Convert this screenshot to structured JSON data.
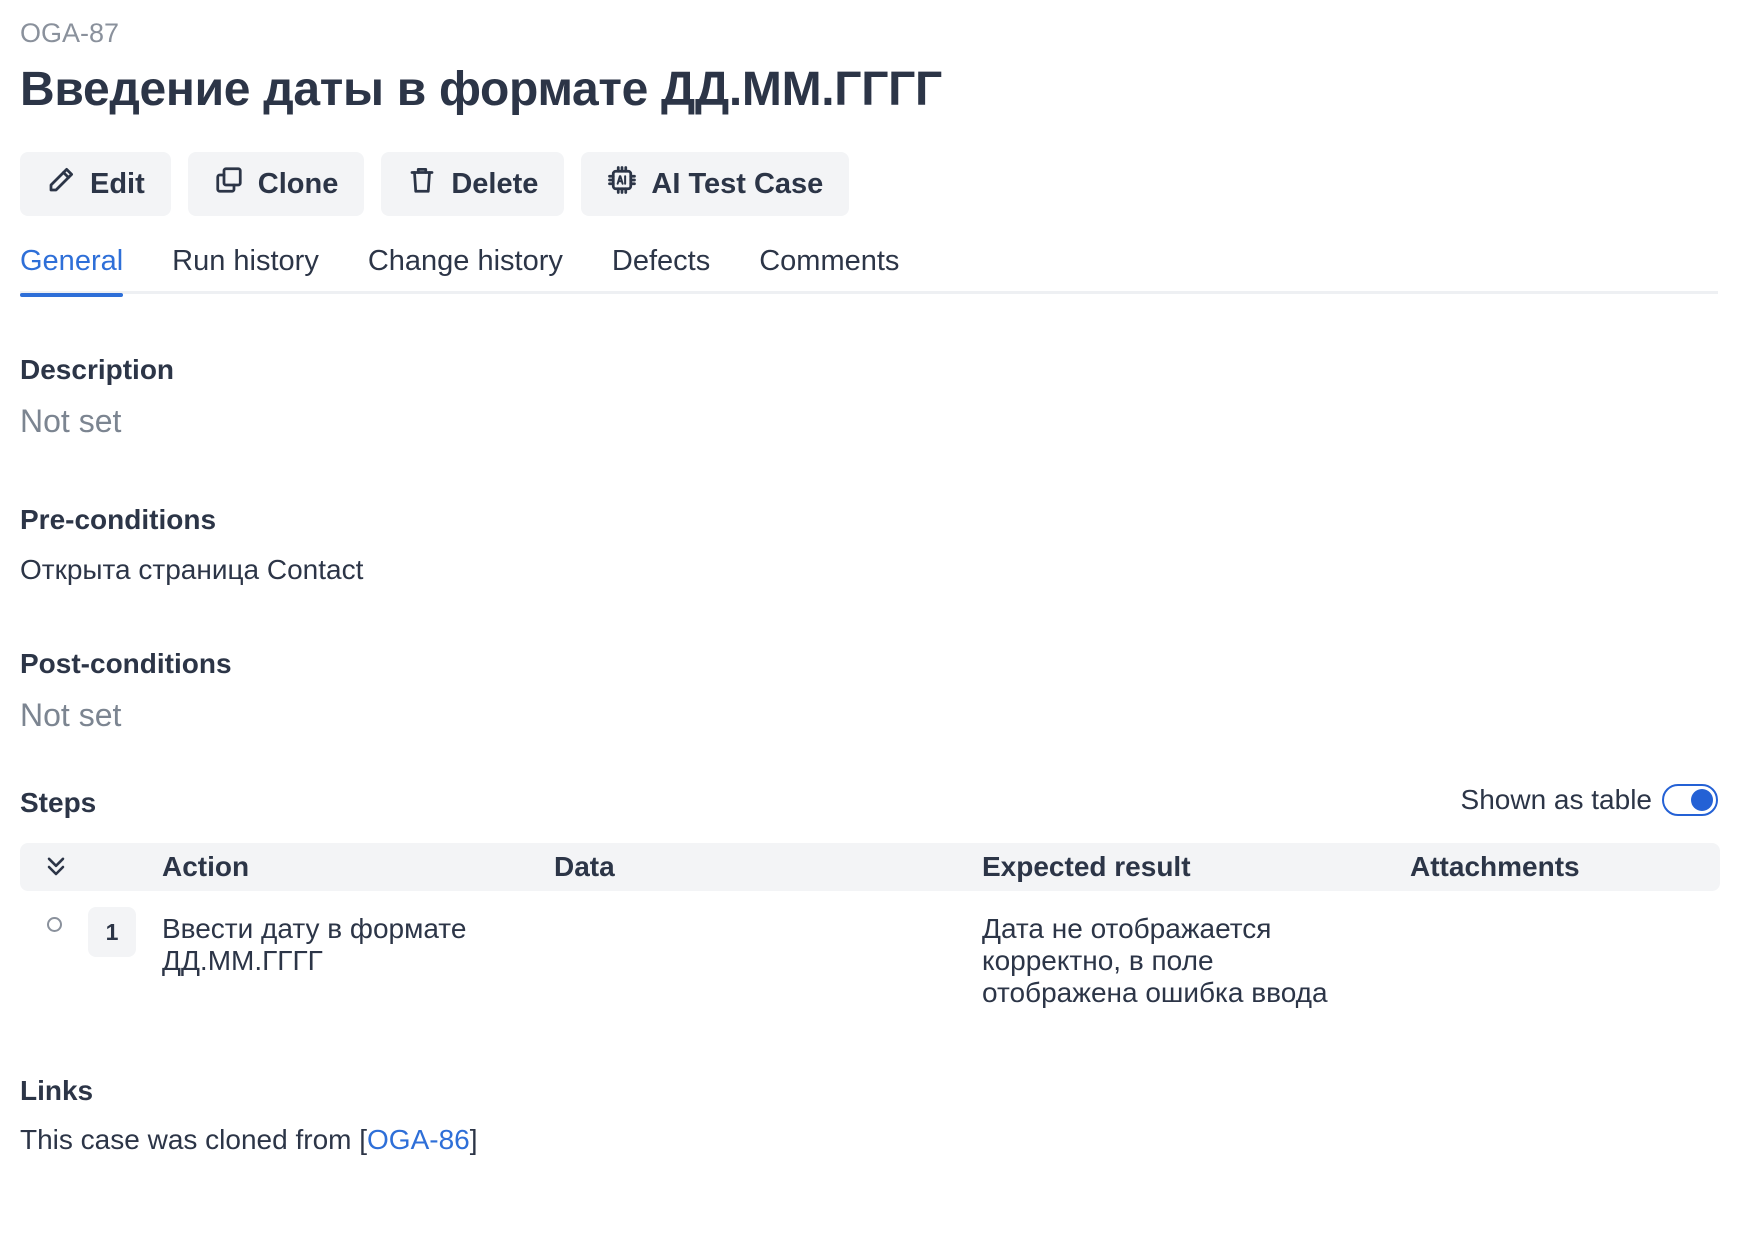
{
  "case": {
    "id": "OGA-87",
    "title": "Введение даты в формате ДД.ММ.ГГГГ"
  },
  "toolbar": {
    "edit_label": "Edit",
    "clone_label": "Clone",
    "delete_label": "Delete",
    "ai_label": "AI Test Case"
  },
  "tabs": [
    {
      "label": "General",
      "active": true
    },
    {
      "label": "Run history",
      "active": false
    },
    {
      "label": "Change history",
      "active": false
    },
    {
      "label": "Defects",
      "active": false
    },
    {
      "label": "Comments",
      "active": false
    }
  ],
  "description": {
    "title": "Description",
    "value": "Not set"
  },
  "preconditions": {
    "title": "Pre-conditions",
    "value": "Открыта страница Contact"
  },
  "postconditions": {
    "title": "Post-conditions",
    "value": "Not set"
  },
  "steps": {
    "title": "Steps",
    "toggle_label": "Shown as table",
    "toggle_on": true,
    "columns": {
      "action": "Action",
      "data": "Data",
      "expected": "Expected result",
      "attachments": "Attachments"
    },
    "rows": [
      {
        "number": "1",
        "action_line1": "Ввести дату в формате",
        "action_line2": "ДД.ММ.ГГГГ",
        "data": "",
        "expected_line1": "Дата не отображается",
        "expected_line2": "корректно, в поле",
        "expected_line3": "отображена ошибка ввода",
        "attachments": ""
      }
    ]
  },
  "links": {
    "title": "Links",
    "text_prefix": "This case was cloned from [",
    "link_label": "OGA-86",
    "text_suffix": "]"
  },
  "colors": {
    "accent": "#2e6fd8",
    "toggle": "#2461d5",
    "text": "#2c3547",
    "muted": "#7c8591",
    "button_bg": "#f3f4f6"
  },
  "icons": {
    "edit": "pencil-icon",
    "clone": "copy-icon",
    "delete": "trash-icon",
    "ai": "ai-chip-icon",
    "collapse": "double-chevron-down-icon"
  }
}
